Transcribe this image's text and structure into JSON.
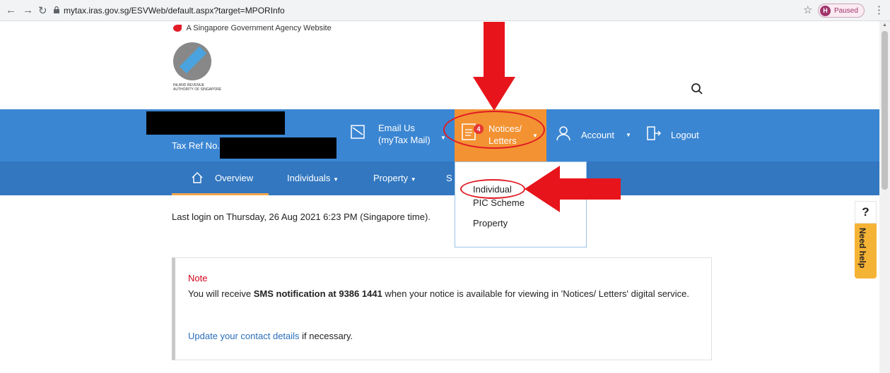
{
  "browser": {
    "url": "mytax.iras.gov.sg/ESVWeb/default.aspx?target=MPORInfo",
    "profile_initial": "H",
    "profile_status": "Paused"
  },
  "gov_banner": "A Singapore Government Agency Website",
  "logo_text": "INLAND REVENUE AUTHORITY OF SINGAPORE",
  "header": {
    "tax_ref_label": "Tax Ref No.",
    "email_line1": "Email Us",
    "email_line2": "(myTax Mail)",
    "notices_line1": "Notices/",
    "notices_line2": "Letters",
    "notices_badge": "4",
    "account_label": "Account",
    "logout_label": "Logout"
  },
  "subnav": {
    "overview": "Overview",
    "individuals": "Individuals",
    "property": "Property",
    "partial": "S"
  },
  "dropdown": {
    "items": [
      "Individual",
      "PIC Scheme",
      "Property"
    ]
  },
  "content": {
    "last_login": "Last login on Thursday, 26 Aug 2021 6:23 PM (Singapore time).",
    "note_heading": "Note",
    "note_pre": "You will receive ",
    "note_bold": "SMS notification at 9386 1441",
    "note_post": " when your notice is available for viewing in 'Notices/ Letters' digital service.",
    "update_link": "Update your contact details",
    "update_post": " if necessary."
  },
  "help": {
    "question": "?",
    "label": "Need help"
  },
  "colors": {
    "header_blue": "#3b86d2",
    "subnav_blue": "#3277c0",
    "notices_orange": "#f39232",
    "annotation_red": "#e01b24"
  }
}
